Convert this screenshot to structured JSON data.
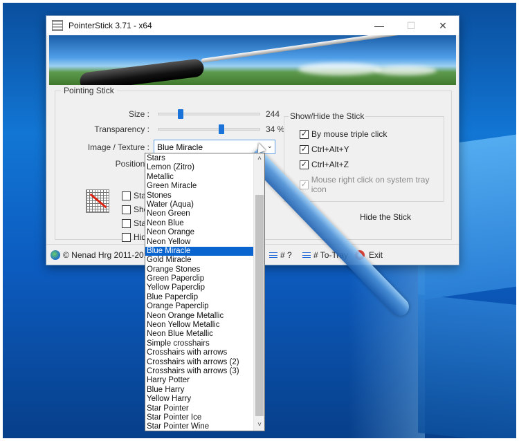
{
  "window": {
    "title": "PointerStick 3.71 - x64",
    "minimize": "—",
    "maximize": "☐",
    "close": "✕"
  },
  "pointing_stick": {
    "group_title": "Pointing Stick",
    "size_label": "Size :",
    "size_value": "244",
    "size_fraction": 0.2,
    "transparency_label": "Transparency :",
    "transparency_value": "34 %",
    "transparency_fraction": 0.62,
    "image_label": "Image / Texture :",
    "image_selected": "Blue Miracle",
    "position_label": "Position :",
    "left_checks": [
      {
        "label": "Start w",
        "checked": false
      },
      {
        "label": "Show",
        "checked": false
      },
      {
        "label": "Start th",
        "checked": false
      },
      {
        "label": "Hide S",
        "checked": false
      }
    ]
  },
  "show_hide": {
    "title": "Show/Hide the Stick",
    "options": [
      {
        "label": "By mouse triple click",
        "checked": true,
        "disabled": false
      },
      {
        "label": "Ctrl+Alt+Y",
        "checked": true,
        "disabled": false
      },
      {
        "label": "Ctrl+Alt+Z",
        "checked": true,
        "disabled": false
      },
      {
        "label": "Mouse right click on system tray icon",
        "checked": true,
        "disabled": true
      }
    ],
    "hide_button": "Hide the Stick"
  },
  "statusbar": {
    "copyright": "© Nenad Hrg 2011-2019",
    "help": "# ?",
    "to_tray": "# To-Tray",
    "exit": "Exit"
  },
  "dropdown": {
    "items": [
      "Stars",
      "Lemon (Zitro)",
      "Metallic",
      "Green Miracle",
      "Stones",
      "Water (Aqua)",
      "Neon Green",
      "Neon Blue",
      "Neon Orange",
      "Neon Yellow",
      "Blue Miracle",
      "Gold Miracle",
      "Orange Stones",
      "Green Paperclip",
      "Yellow Paperclip",
      "Blue Paperclip",
      "Orange Paperclip",
      "Neon Orange Metallic",
      "Neon Yellow Metallic",
      "Neon Blue Metallic",
      "Simple crosshairs",
      "Crosshairs with arrows",
      "Crosshairs with arrows (2)",
      "Crosshairs with arrows (3)",
      "Harry Potter",
      "Blue Harry",
      "Yellow Harry",
      "Star Pointer",
      "Star Pointer Ice",
      "Star Pointer Wine"
    ],
    "selected_index": 10
  }
}
